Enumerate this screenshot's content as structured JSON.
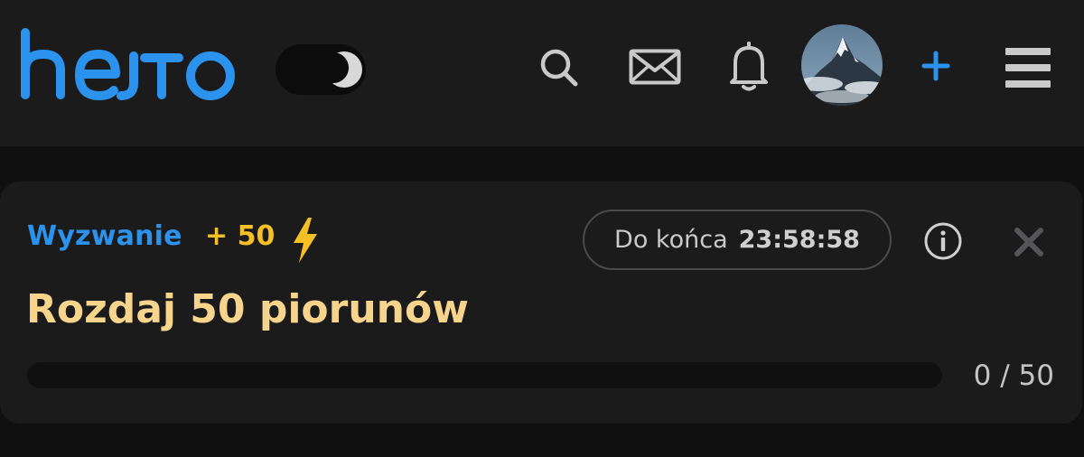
{
  "header": {
    "logo_text": "hejto",
    "theme_toggle": {
      "mode": "dark",
      "icon": "moon-icon"
    },
    "icons": [
      "search-icon",
      "mail-icon",
      "bell-icon",
      "avatar",
      "plus-icon",
      "menu-icon"
    ],
    "brand_color": "#2b93ed"
  },
  "challenge": {
    "label": "Wyzwanie",
    "points": "+ 50",
    "points_icon": "lightning-icon",
    "timer_label": "Do końca",
    "timer_value": "23:58:58",
    "title": "Rozdaj 50 piorunów",
    "progress_current": 0,
    "progress_total": 50,
    "progress_text": "0 / 50",
    "accent_color": "#f5c026",
    "title_color": "#f7d48c"
  }
}
